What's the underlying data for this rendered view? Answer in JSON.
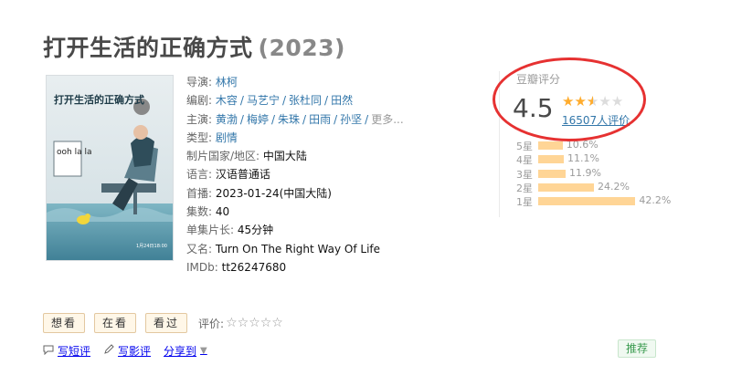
{
  "title": "打开生活的正确方式",
  "year": "(2023)",
  "poster": {
    "title_text": "打开生活的正确方式",
    "sign_text": "ooh la la",
    "date_text": "1月24日18:00"
  },
  "info": {
    "director": {
      "label": "导演:",
      "names": [
        "林柯"
      ]
    },
    "writer": {
      "label": "编剧:",
      "names": [
        "木容",
        "马艺宁",
        "张杜同",
        "田然"
      ]
    },
    "cast": {
      "label": "主演:",
      "names": [
        "黄渤",
        "梅婷",
        "朱珠",
        "田雨",
        "孙坚"
      ],
      "more": "更多..."
    },
    "genre": {
      "label": "类型:",
      "value": "剧情"
    },
    "country": {
      "label": "制片国家/地区:",
      "value": "中国大陆"
    },
    "language": {
      "label": "语言:",
      "value": "汉语普通话"
    },
    "premiere": {
      "label": "首播:",
      "value": "2023-01-24(中国大陆)"
    },
    "episodes": {
      "label": "集数:",
      "value": "40"
    },
    "runtime": {
      "label": "单集片长:",
      "value": "45分钟"
    },
    "aka": {
      "label": "又名:",
      "value": "Turn On The Right Way Of Life"
    },
    "imdb": {
      "label": "IMDb:",
      "value": "tt26247680"
    }
  },
  "rating": {
    "title": "豆瓣评分",
    "score": "4.5",
    "stars_value": 2.5,
    "star_full": "★",
    "star_empty": "★",
    "votes": "16507人评价",
    "histogram": [
      {
        "label": "5星",
        "pct_text": "10.6%",
        "pct": 10.6
      },
      {
        "label": "4星",
        "pct_text": "11.1%",
        "pct": 11.1
      },
      {
        "label": "3星",
        "pct_text": "11.9%",
        "pct": 11.9
      },
      {
        "label": "2星",
        "pct_text": "24.2%",
        "pct": 24.2
      },
      {
        "label": "1星",
        "pct_text": "42.2%",
        "pct": 42.2
      }
    ],
    "highlight_color": "#e63131",
    "star_color": "#ffac2d",
    "bar_color": "#ffd596"
  },
  "actions": {
    "want": "想看",
    "watching": "在看",
    "watched": "看过",
    "rate_label": "评价:",
    "rate_stars": "☆☆☆☆☆"
  },
  "links": {
    "short_review": "写短评",
    "review": "写影评",
    "share": "分享到",
    "share_caret": "▼"
  },
  "recommend": "推荐"
}
